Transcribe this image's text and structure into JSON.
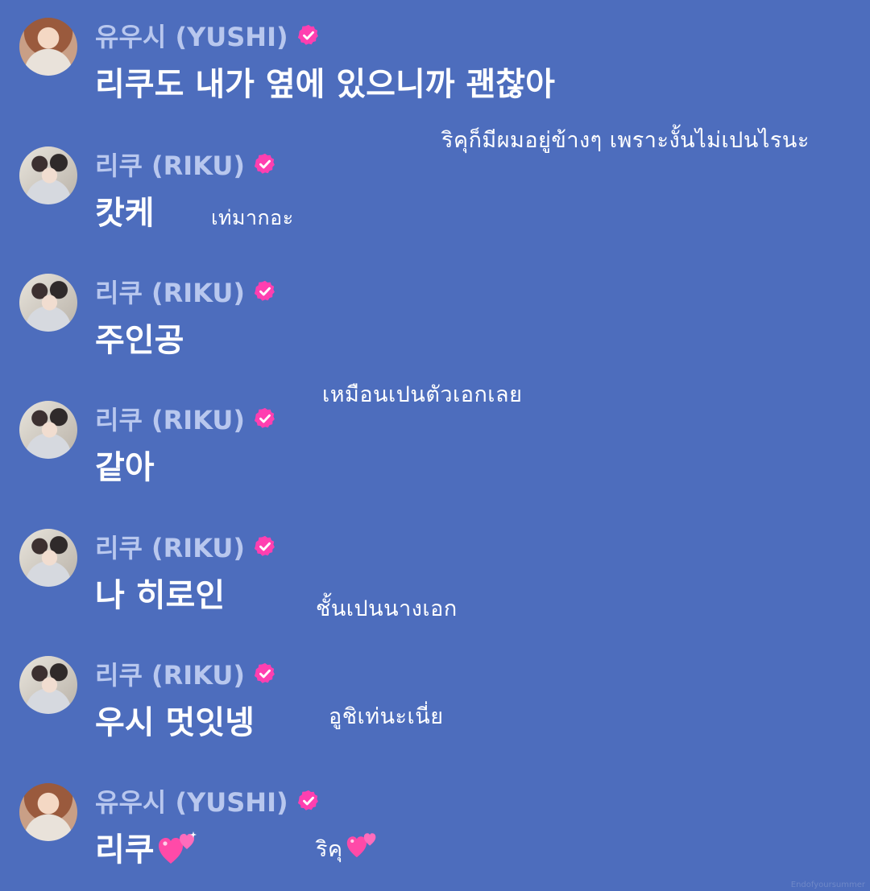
{
  "messages": [
    {
      "sender": "유우시 (YUSHI)",
      "text": "리쿠도 내가 옆에 있으니까 괜찮아",
      "avatar": "yushi-avatar"
    },
    {
      "sender": "리쿠 (RIKU)",
      "text": "캇케",
      "avatar": "riku-avatar"
    },
    {
      "sender": "리쿠 (RIKU)",
      "text": "주인공",
      "avatar": "riku-avatar"
    },
    {
      "sender": "리쿠 (RIKU)",
      "text": "같아",
      "avatar": "riku-avatar"
    },
    {
      "sender": "리쿠 (RIKU)",
      "text": "나 히로인",
      "avatar": "riku-avatar"
    },
    {
      "sender": "리쿠 (RIKU)",
      "text": "우시 멋잇넹",
      "avatar": "riku-avatar"
    },
    {
      "sender": "유우시 (YUSHI)",
      "text": "리쿠",
      "avatar": "yushi-avatar",
      "text_icon": "two-hearts-icon"
    }
  ],
  "translations": [
    "ริคุก็มีผมอยู่ข้างๆ  เพราะงั้นไม่เปนไรนะ",
    "เท่มากอะ",
    "เหมือนเปนตัวเอกเลย",
    "ชั้นเปนนางเอก",
    "อูชิเท่นะเนี่ย",
    "ริคุ"
  ],
  "badge_icon": "verified-badge-icon",
  "colors": {
    "background": "#4d6dbd",
    "sender_name": "#b8c7ee",
    "message_text": "#ffffff",
    "badge": "#ff3fb0",
    "heart": "#ff4aa8"
  },
  "watermark": "Endofyoursummer"
}
